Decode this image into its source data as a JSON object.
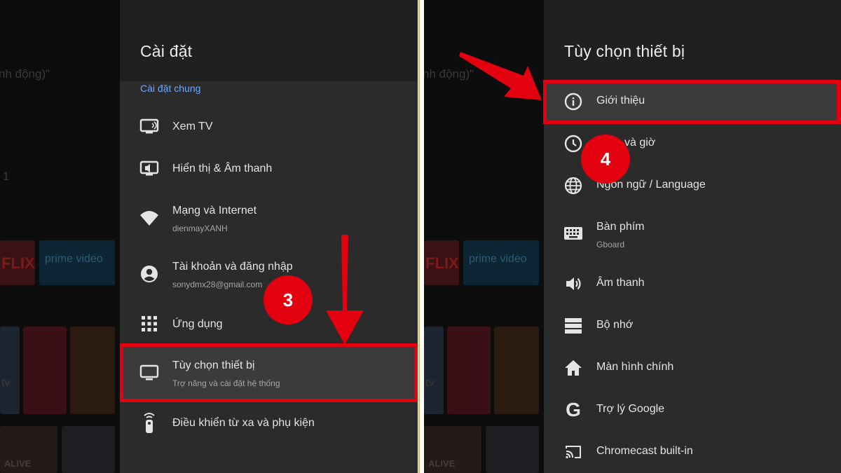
{
  "left": {
    "title": "Cài đặt",
    "section": "Cài đặt chung",
    "background": {
      "text_top": "nh động)\"",
      "text_num": "1",
      "tv_label": "tv",
      "netflix": "FLIX",
      "prime": "prime video",
      "alive": "ALIVE"
    },
    "items": [
      {
        "icon": "tv-icon",
        "label": "Xem TV",
        "sub": ""
      },
      {
        "icon": "display-sound-icon",
        "label": "Hiển thị & Âm thanh",
        "sub": ""
      },
      {
        "icon": "wifi-icon",
        "label": "Mạng và Internet",
        "sub": "dienmayXANH"
      },
      {
        "icon": "account-icon",
        "label": "Tài khoản và đăng nhập",
        "sub": "sonydmx28@gmail.com"
      },
      {
        "icon": "apps-grid-icon",
        "label": "Ứng dụng",
        "sub": ""
      },
      {
        "icon": "monitor-icon",
        "label": "Tùy chọn thiết bị",
        "sub": "Trợ năng và cài đặt hệ thống"
      },
      {
        "icon": "remote-icon",
        "label": "Điều khiển từ xa và phụ kiện",
        "sub": ""
      }
    ],
    "step": "3"
  },
  "right": {
    "title": "Tùy chọn thiết bị",
    "background": {
      "text_top": "nh động)\"",
      "tv_label": "tv",
      "netflix": "FLIX",
      "prime": "prime video",
      "alive": "ALIVE"
    },
    "items": [
      {
        "icon": "info-icon",
        "label": "Giới thiệu",
        "sub": ""
      },
      {
        "icon": "clock-icon",
        "label": "và giờ",
        "sub": ""
      },
      {
        "icon": "globe-icon",
        "label": "Ngôn ngữ / Language",
        "sub": ""
      },
      {
        "icon": "keyboard-icon",
        "label": "Bàn phím",
        "sub": "Gboard"
      },
      {
        "icon": "volume-icon",
        "label": "Âm thanh",
        "sub": ""
      },
      {
        "icon": "storage-icon",
        "label": "Bộ nhớ",
        "sub": ""
      },
      {
        "icon": "home-icon",
        "label": "Màn hình chính",
        "sub": ""
      },
      {
        "icon": "google-icon",
        "label": "Trợ lý Google",
        "sub": ""
      },
      {
        "icon": "cast-icon",
        "label": "Chromecast built-in",
        "sub": ""
      }
    ],
    "step": "4"
  },
  "colors": {
    "highlight": "#e3000f",
    "accent": "#6ea8ff",
    "panel": "#2b2b2b"
  }
}
